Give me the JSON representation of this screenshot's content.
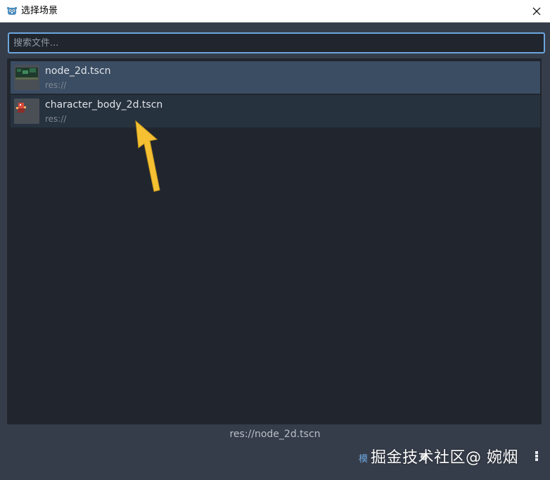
{
  "window": {
    "title": "选择场景"
  },
  "search": {
    "placeholder": "搜索文件..."
  },
  "items": [
    {
      "name": "node_2d.tscn",
      "path": "res://",
      "thumb_icon": "scene-thumbnail-icon"
    },
    {
      "name": "character_body_2d.tscn",
      "path": "res://",
      "thumb_icon": "character-thumbnail-icon"
    }
  ],
  "footer": {
    "selected_path": "res://node_2d.tscn",
    "option_label": "模"
  },
  "watermark": "掘金技术社区@ 婉烟",
  "colors": {
    "accent": "#6ca6dd",
    "arrow": "#f5c032",
    "panel": "#21262e",
    "background": "#363d4a",
    "selected": "#3b4d63"
  }
}
